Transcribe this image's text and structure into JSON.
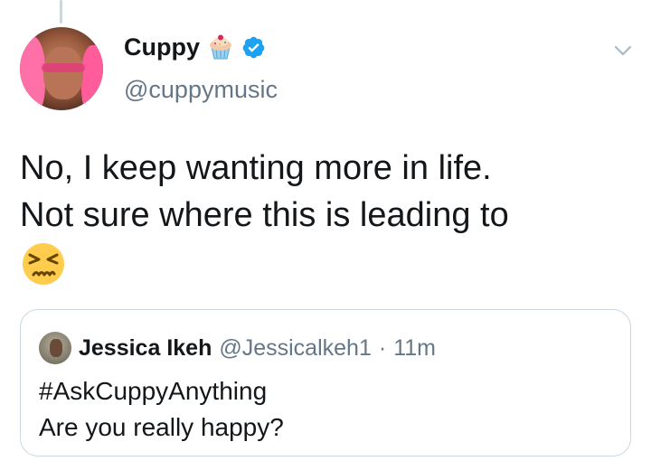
{
  "tweet": {
    "author_name": "Cuppy",
    "author_handle": "@cuppymusic",
    "text_lines": [
      "No, I keep wanting more in life.",
      "Not sure where this is leading to"
    ],
    "emoji": "persevering-face"
  },
  "quoted_tweet": {
    "author_name": "Jessica Ikeh",
    "author_handle": "@Jessicalkeh1",
    "separator": "·",
    "time": "11m",
    "lines": [
      "#AskCuppyAnything",
      "Are you really happy?"
    ]
  },
  "colors": {
    "text": "#14171a",
    "secondary": "#657786",
    "border": "#ccd6dd",
    "verified": "#1da1f2",
    "emoji": "#ffcc4d"
  }
}
